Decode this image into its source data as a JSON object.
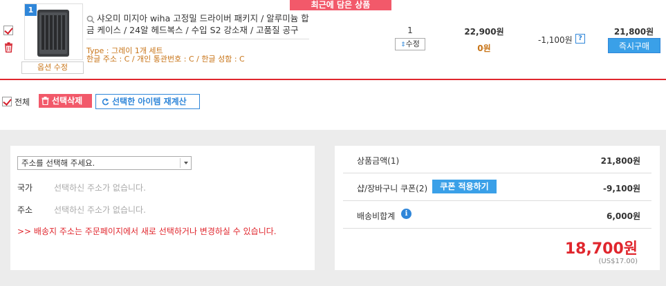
{
  "recent_tab": {
    "label": "최근에 담은 상품"
  },
  "item": {
    "badge": "1",
    "option_edit_label": "옵션 수정",
    "name": "샤오미 미지아 wiha 고정밀 드라이버 패키지 / 알루미늄 합금 케이스 / 24알 헤드복스 / 수입 S2 강소재 / 고품질 공구",
    "option_type": "Type : 그레이 1개 세트",
    "option_extra": "한글 주소 : C / 개인 통관번호 : C / 한글 성함 : C",
    "quantity": "1",
    "qty_edit_label": "수정",
    "price": "22,900원",
    "price_discount": "0원",
    "discount": "-1,100원",
    "help_label": "?",
    "total": "21,800원",
    "buy_label": "즉시구매"
  },
  "actions": {
    "all_label": "전체",
    "delete_selected_label": "선택삭제",
    "recalc_label": "선택한 아이템 재계산"
  },
  "address": {
    "select_placeholder": "주소를 선택해 주세요.",
    "country_label": "국가",
    "country_value": "선택하신 주소가 없습니다.",
    "addr_label": "주소",
    "addr_value": "선택하신 주소가 없습니다.",
    "notice": ">> 배송지 주소는 주문페이지에서 새로 선택하거나 변경하실 수 있습니다."
  },
  "summary": {
    "goods_label": "상품금액(1)",
    "goods_value": "21,800원",
    "coupon_label": "샵/장바구니 쿠폰(2)",
    "coupon_btn": "쿠폰 적용하기",
    "coupon_value": "-9,100원",
    "shipping_label": "배송비합계",
    "shipping_info": "i",
    "shipping_value": "6,000원",
    "grand_total": "18,700원",
    "usd_total": "(US$17.00)"
  },
  "colors": {
    "accent_red": "#e0262d",
    "accent_blue": "#2f86d9",
    "option_orange": "#c87417",
    "pink_button": "#f2596a"
  }
}
